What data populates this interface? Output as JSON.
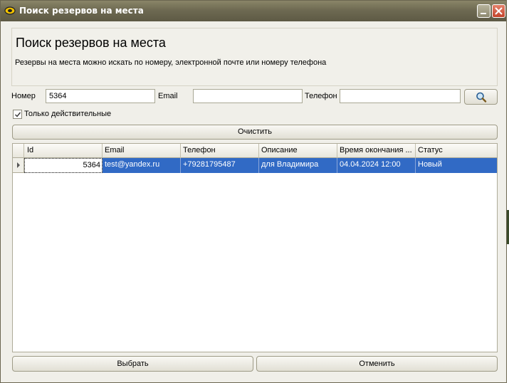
{
  "window": {
    "title": "Поиск резервов на места"
  },
  "header": {
    "title": "Поиск резервов на места",
    "subtitle": "Резервы на места можно искать по номеру, электронной почте или номеру телефона"
  },
  "search": {
    "number_label": "Номер",
    "number_value": "5364",
    "email_label": "Email",
    "email_value": "",
    "phone_label": "Телефон",
    "phone_value": "",
    "only_valid_label": "Только действительные",
    "only_valid_checked": true,
    "clear_label": "Очистить"
  },
  "table": {
    "columns": [
      "Id",
      "Email",
      "Телефон",
      "Описание",
      "Время окончания ...",
      "Статус"
    ],
    "rows": [
      {
        "id": "5364",
        "email": "test@yandex.ru",
        "phone": "+79281795487",
        "description": "для Владимира",
        "end_time": "04.04.2024 12:00",
        "status": "Новый"
      }
    ]
  },
  "footer": {
    "select_label": "Выбрать",
    "cancel_label": "Отменить"
  },
  "colors": {
    "titlebar": "#6e6a52",
    "selection": "#316ac5",
    "window_bg": "#f0efe9"
  }
}
